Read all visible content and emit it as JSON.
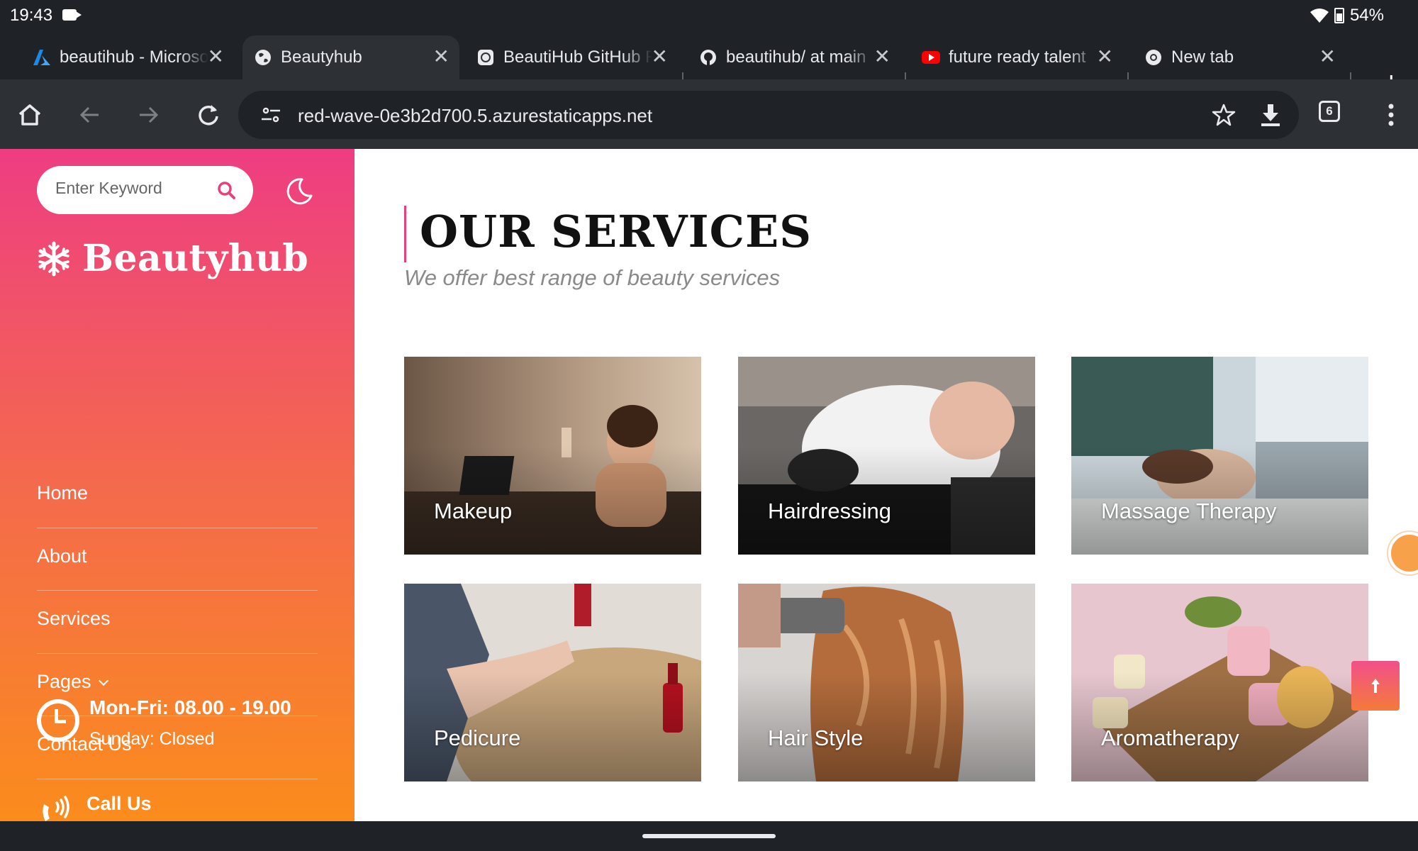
{
  "status_bar": {
    "time": "19:43",
    "battery": "54%"
  },
  "tabs": [
    {
      "label": "beautihub - Microsoft Azure",
      "icon": "azure-icon"
    },
    {
      "label": "Beautyhub",
      "icon": "globe-icon",
      "active": true
    },
    {
      "label": "BeautiHub GitHub Repo",
      "icon": "openai-icon"
    },
    {
      "label": "beautihub/ at main",
      "icon": "github-icon"
    },
    {
      "label": "future ready talent",
      "icon": "youtube-icon"
    },
    {
      "label": "New tab",
      "icon": "chrome-icon"
    }
  ],
  "toolbar": {
    "url": "red-wave-0e3b2d700.5.azurestaticapps.net",
    "tab_count": "6"
  },
  "sidebar": {
    "search_placeholder": "Enter Keyword",
    "brand": "Beautyhub",
    "nav": [
      {
        "label": "Home"
      },
      {
        "label": "About"
      },
      {
        "label": "Services"
      },
      {
        "label": "Pages",
        "has_dropdown": true
      },
      {
        "label": "Contact Us"
      }
    ],
    "hours_main": "Mon-Fri: 08.00 - 19.00",
    "hours_sub": "Sunday: Closed",
    "call_label": "Call Us"
  },
  "main": {
    "title": "OUR SERVICES",
    "subtitle": "We offer best range of beauty services",
    "services": [
      {
        "label": "Makeup"
      },
      {
        "label": "Hairdressing"
      },
      {
        "label": "Massage Therapy"
      },
      {
        "label": "Pedicure"
      },
      {
        "label": "Hair Style"
      },
      {
        "label": "Aromatherapy"
      }
    ]
  },
  "colors": {
    "accent": "#e8407c",
    "gradient_top": "#ee3d82",
    "gradient_bottom": "#fb8c1c"
  }
}
